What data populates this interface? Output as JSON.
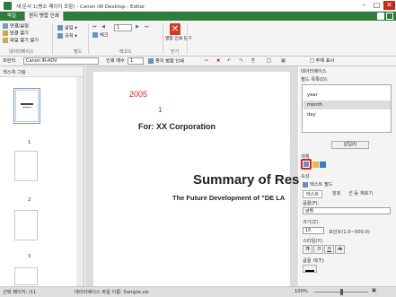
{
  "window": {
    "title": "새 문서 1(병소 페이지 포함) - Canon iW Desktop - Editor",
    "minimize": "–",
    "maximize": "□",
    "close": "✕"
  },
  "tabs": [
    "파일",
    "편지 병합 인쇄"
  ],
  "ribbon": {
    "datasource": {
      "setup": "연결/설정",
      "open": "연결 열기",
      "open_file": "파일 열기 열기",
      "group": "데이터베이스"
    },
    "fields": {
      "insert": "삽입",
      "rule": "규칙",
      "check": "체크",
      "group": "필드"
    },
    "preview": {
      "group": "레코드"
    },
    "page_value": "1",
    "close": {
      "label": "병합 인쇄 닫기",
      "group": "닫기"
    }
  },
  "toolbar2": {
    "printer_label": "프린터",
    "printer_value": "Canon iR-ADV",
    "copies_label": "인쇄 매수",
    "copies_value": "1",
    "merge_print": "편지 병합 인쇄",
    "show_fields": "□ 주제 표시"
  },
  "left_panel": {
    "title": "섹스쳐 그림",
    "pages": [
      "1",
      "2",
      "3"
    ]
  },
  "document": {
    "year": "2005",
    "page_num": "1",
    "company": "For: XX Corporation",
    "summary": "Summary of Res",
    "subtitle": "The Future Development of \"DE LA"
  },
  "right_panel": {
    "db_title": "데이터베이스",
    "field_list_label": "필드 목록(D):",
    "fields": [
      "year",
      "month",
      "day"
    ],
    "selected_field": "month",
    "insert_button": "삽입(I)",
    "type_label": "개체",
    "prop_title": "속성",
    "text_field_tab": "텍스트 필드",
    "subtabs": [
      "텍스트",
      "장호",
      "선 등 재호기"
    ],
    "font_label": "글꼴(F):",
    "font_value": "굴림",
    "size_label": "크기(Z):",
    "size_value": "15",
    "size_unit": "포인트(1.0~500.0)",
    "style_label": "스타일(Y):",
    "style_buttons": [
      "가",
      "가",
      "가",
      "가"
    ],
    "color_label": "글꼴 색(T):"
  },
  "status": {
    "page": "선택 페이지: /11",
    "datasource": "데이터베이스 파일 이름: Sample.xls",
    "zoom": "100%"
  },
  "colors": {
    "accent_green": "#2e7d3a",
    "close_red": "#d43a2a",
    "highlight_red": "#e02020"
  }
}
